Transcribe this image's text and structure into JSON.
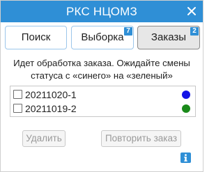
{
  "window": {
    "title": "РКС НЦОМЗ",
    "close_icon": "close-icon"
  },
  "tabs": [
    {
      "label": "Поиск",
      "badge": ""
    },
    {
      "label": "Выборка",
      "badge": "7"
    },
    {
      "label": "Заказы",
      "badge": "2",
      "active": true
    }
  ],
  "info_message": "Идет обработка заказа. Ожидайте смены статуса с «синего» на «зеленый»",
  "orders": [
    {
      "id": "20211020-1",
      "checked": false,
      "status_color": "#1414e6"
    },
    {
      "id": "20211019-2",
      "checked": false,
      "status_color": "#1a8a1a"
    }
  ],
  "actions": {
    "delete_label": "Удалить",
    "repeat_label": "Повторить заказ"
  },
  "colors": {
    "accent": "#2f8fd6"
  },
  "footer": {
    "info_icon": "info-icon"
  }
}
